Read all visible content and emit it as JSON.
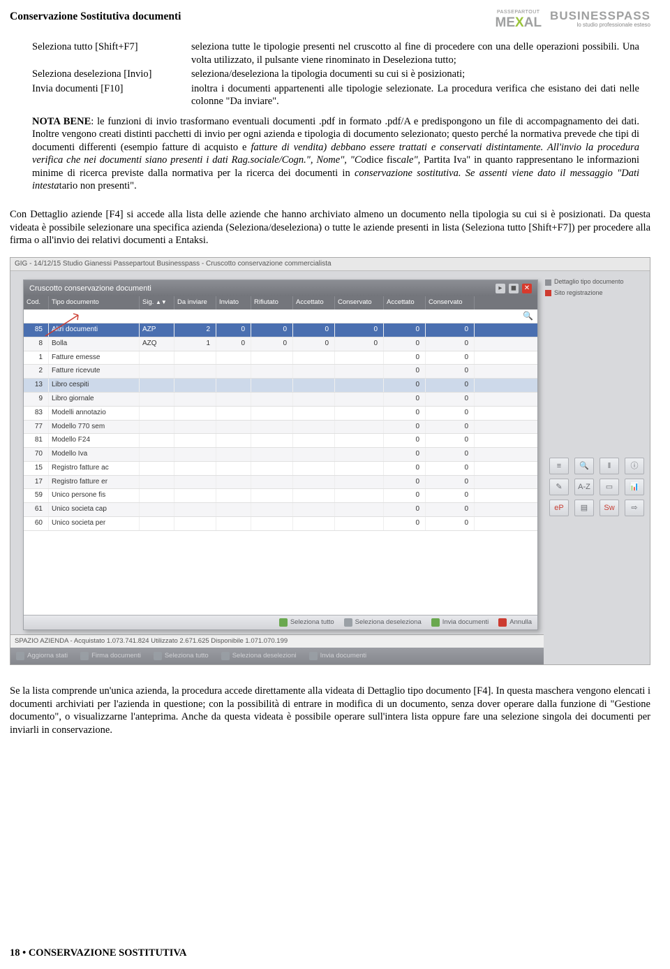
{
  "header": {
    "doc_title": "Conservazione Sostitutiva documenti",
    "logo_mexal_small": "PASSEPARTOUT",
    "logo_mexal_big_pre": "ME",
    "logo_mexal_big_x": "X",
    "logo_mexal_big_post": "AL",
    "logo_bp_big": "BUSINESSPASS",
    "logo_bp_small": "lo studio professionale esteso"
  },
  "defs": [
    {
      "term": "Seleziona tutto [Shift+F7]",
      "desc": "seleziona tutte le tipologie presenti nel cruscotto al fine di procedere con una delle operazioni possibili. Una volta utilizzato, il pulsante viene rinominato in Deseleziona tutto;"
    },
    {
      "term": "Seleziona deseleziona [Invio]",
      "desc": "seleziona/deseleziona la tipologia documenti su cui si è posizionati;"
    },
    {
      "term": "Invia documenti [F10]",
      "desc": "inoltra i documenti appartenenti alle tipologie selezionate. La procedura verifica che esistano dei dati nelle colonne \"Da inviare\"."
    }
  ],
  "nota_label": "NOTA BENE",
  "nota_text_a": ": le funzioni di invio trasformano eventuali documenti .pdf in formato .pdf/A e predispongono un file di accompagnamento dei dati. Inoltre vengono creati distinti pacchetti di invio per ogni azienda e tipologia di documento selezionato; questo perché la normativa prevede che tipi di documenti differenti (esempio fatture di acquisto e ",
  "nota_text_b": "fatture di vendita) debbano essere trattati e conservati distintamente. All'invio la procedura verifica che nei documenti siano presenti i dati Rag.sociale/Cogn.\", Nome\", \"Co",
  "nota_text_c": "dice fisc",
  "nota_text_d": "ale\", ",
  "nota_text_e": "Partita Iva\" in quanto rappresentano le informazioni minime di ricerca previste dalla normativa per la ricerca dei documenti in ",
  "nota_text_f": "conservazione sostitutiva. Se assenti viene dato il messaggio \"Dati intesta",
  "nota_text_g": "tario non presenti\".",
  "mid_paragraph": "Con Dettaglio aziende [F4] si accede alla lista delle aziende che hanno archiviato almeno un documento nella tipologia su cui si è posizionati. Da questa videata è possibile selezionare una specifica azienda (Seleziona/deseleziona) o tutte le aziende presenti in lista (Seleziona tutto [Shift+F7]) per procedere alla firma o all'invio dei relativi documenti a Entaksi.",
  "app": {
    "titlebar": "GIG - 14/12/15  Studio Gianessi  Passepartout Businesspass - Cruscotto conservazione commercialista",
    "panel_title": "Cruscotto conservazione documenti",
    "cols": [
      "Cod.",
      "Tipo documento",
      "Sig.",
      "Da inviare",
      "Inviato",
      "Rifiutato",
      "Accettato",
      "Conservato",
      "Accettato",
      "Conservato"
    ],
    "sort_glyph": "▲▼",
    "rows": [
      {
        "cod": "85",
        "tipo": "Altri documenti",
        "sig": "AZP",
        "v": [
          "2",
          "0",
          "0",
          "0",
          "0",
          "0",
          "0"
        ],
        "sel": true
      },
      {
        "cod": "8",
        "tipo": "Bolla",
        "sig": "AZQ",
        "v": [
          "1",
          "0",
          "0",
          "0",
          "0",
          "0",
          "0"
        ]
      },
      {
        "cod": "1",
        "tipo": "Fatture emesse",
        "sig": "",
        "v": [
          "",
          "",
          "",
          "",
          "",
          "0",
          "0"
        ]
      },
      {
        "cod": "2",
        "tipo": "Fatture ricevute",
        "sig": "",
        "v": [
          "",
          "",
          "",
          "",
          "",
          "0",
          "0"
        ]
      },
      {
        "cod": "13",
        "tipo": "Libro cespiti",
        "sig": "",
        "v": [
          "",
          "",
          "",
          "",
          "",
          "0",
          "0"
        ],
        "hl": true
      },
      {
        "cod": "9",
        "tipo": "Libro giornale",
        "sig": "",
        "v": [
          "",
          "",
          "",
          "",
          "",
          "0",
          "0"
        ]
      },
      {
        "cod": "83",
        "tipo": "Modelli annotazio",
        "sig": "",
        "v": [
          "",
          "",
          "",
          "",
          "",
          "0",
          "0"
        ]
      },
      {
        "cod": "77",
        "tipo": "Modello 770 sem",
        "sig": "",
        "v": [
          "",
          "",
          "",
          "",
          "",
          "0",
          "0"
        ]
      },
      {
        "cod": "81",
        "tipo": "Modello F24",
        "sig": "",
        "v": [
          "",
          "",
          "",
          "",
          "",
          "0",
          "0"
        ]
      },
      {
        "cod": "70",
        "tipo": "Modello Iva",
        "sig": "",
        "v": [
          "",
          "",
          "",
          "",
          "",
          "0",
          "0"
        ]
      },
      {
        "cod": "15",
        "tipo": "Registro fatture ac",
        "sig": "",
        "v": [
          "",
          "",
          "",
          "",
          "",
          "0",
          "0"
        ]
      },
      {
        "cod": "17",
        "tipo": "Registro fatture er",
        "sig": "",
        "v": [
          "",
          "",
          "",
          "",
          "",
          "0",
          "0"
        ]
      },
      {
        "cod": "59",
        "tipo": "Unico persone fis",
        "sig": "",
        "v": [
          "",
          "",
          "",
          "",
          "",
          "0",
          "0"
        ]
      },
      {
        "cod": "61",
        "tipo": "Unico societa cap",
        "sig": "",
        "v": [
          "",
          "",
          "",
          "",
          "",
          "0",
          "0"
        ]
      },
      {
        "cod": "60",
        "tipo": "Unico societa per",
        "sig": "",
        "v": [
          "",
          "",
          "",
          "",
          "",
          "0",
          "0"
        ]
      }
    ],
    "panel_footer": [
      {
        "icon": "ic-green",
        "label": "Seleziona tutto"
      },
      {
        "icon": "ic-grey",
        "label": "Seleziona deseleziona"
      },
      {
        "icon": "ic-green",
        "label": "Invia documenti"
      },
      {
        "icon": "ic-red",
        "label": "Annulla"
      }
    ],
    "space_line": "SPAZIO AZIENDA - Acquistato 1.073.741.824   Utilizzato   2.671.625  Disponibile 1.071.070.199",
    "bottom_buttons": [
      "Aggiorna stati",
      "Firma documenti",
      "Seleziona tutto",
      "Seleziona deselezioni",
      "Invia documenti"
    ],
    "right_chips": [
      {
        "cls": "sq-grey",
        "label": "Dettaglio tipo documento"
      },
      {
        "cls": "sq-red",
        "label": "Sito registrazione"
      }
    ],
    "right_icons": [
      "≡",
      "🔍",
      "‖",
      "ⓘ",
      "✎",
      "A-Z",
      "▭",
      "📊",
      "eP",
      "▤",
      "Sw",
      "⇨"
    ]
  },
  "after_paragraph": "Se la lista comprende un'unica azienda, la procedura accede direttamente alla videata di Dettaglio tipo documento [F4]. In questa maschera vengono elencati i documenti archiviati per l'azienda in questione; con la possibilità di entrare in modifica di un documento, senza dover operare dalla funzione di \"Gestione documento\", o visualizzarne l'anteprima. Anche da questa videata è possibile operare sull'intera lista oppure fare una selezione singola dei documenti per inviarli in conservazione.",
  "footer": "18  •  CONSERVAZIONE SOSTITUTIVA"
}
